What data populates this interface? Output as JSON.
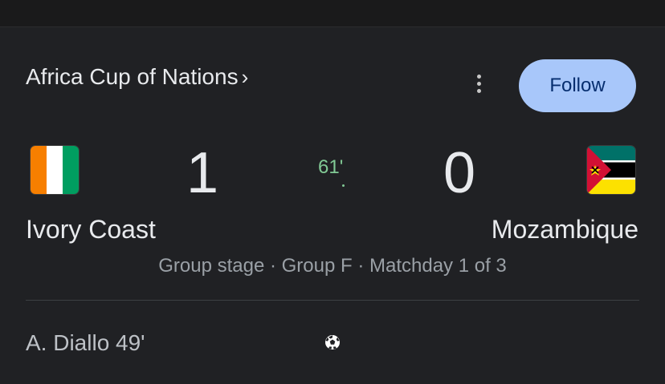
{
  "competition": {
    "name": "Africa Cup of Nations",
    "chevron": "›"
  },
  "actions": {
    "more_icon": "more-vert-icon",
    "follow_label": "Follow"
  },
  "match": {
    "home": {
      "name": "Ivory Coast",
      "score": "1",
      "flag_colors": [
        "#f77f00",
        "#ffffff",
        "#009e60"
      ]
    },
    "away": {
      "name": "Mozambique",
      "score": "0",
      "flag_colors": [
        "#007168",
        "#ffffff",
        "#000000",
        "#fce100",
        "#d21034"
      ]
    },
    "minute": "61'",
    "stage": "Group stage · Group F · Matchday 1 of 3"
  },
  "events": [
    {
      "scorer": "A. Diallo 49'",
      "icon": "soccer-ball-icon"
    }
  ],
  "colors": {
    "background": "#202124",
    "accent_follow": "#a8c7fa",
    "live_minute": "#81c995"
  }
}
